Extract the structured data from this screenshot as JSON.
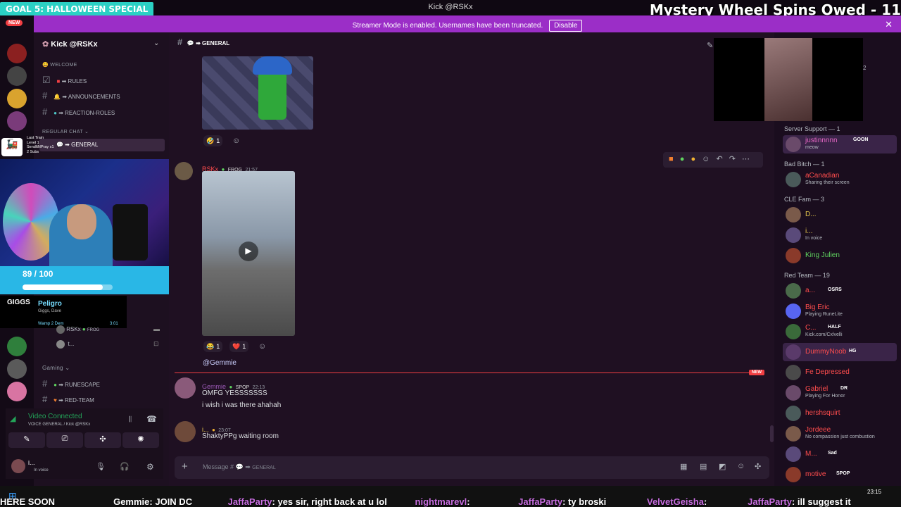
{
  "overlay": {
    "goal_label": "GOAL 5: HALLOWEEN SPECIAL",
    "window_title": "Kick @RSKx",
    "wheel_text": "Mystery Wheel Spins Owed - 11",
    "progress_text": "89 / 100",
    "train_lines": [
      "Last Train",
      "Level 1",
      "SendItNPray x1",
      "2 Subs"
    ],
    "alert_name": "Peligro",
    "alert_sub": "Giggs, Dave",
    "alert_game": "Wamp 2 Dem",
    "alert_timer": "3:01",
    "giggs_label": "GIGGS"
  },
  "banner": {
    "text": "Streamer Mode is enabled. Usernames have been truncated.",
    "button": "Disable",
    "close": "✕"
  },
  "rail": {
    "new_badge": "NEW"
  },
  "sidebar": {
    "server_name": "Kick @RSKx",
    "categories": [
      {
        "name": "WELCOME",
        "emoji": "😀"
      },
      {
        "name": "REGULAR CHAT"
      },
      {
        "name": "Gaming"
      }
    ],
    "channels": [
      "RULES",
      "ANNOUNCEMENTS",
      "REACTION-ROLES",
      "GENERAL",
      "RUNESCAPE",
      "RED-TEAM"
    ],
    "voice_users": [
      {
        "name": "RSKx",
        "tag": "FROG"
      },
      {
        "name": "t..."
      }
    ],
    "voice_connected": {
      "title": "Video Connected",
      "sub": "VOICE GENERAL / Kick @RSKx"
    },
    "user": {
      "name": "i...",
      "status": "In voice"
    }
  },
  "channel": {
    "name": "GENERAL",
    "placeholder": "Message #",
    "placeholder_channel": "GENERAL"
  },
  "messages": [
    {
      "reactions": [
        {
          "emoji": "🤣",
          "count": "1"
        }
      ]
    },
    {
      "author": "RSKx",
      "tag": "FROG",
      "time": "21:57",
      "reactions": [
        {
          "emoji": "😂",
          "count": "1"
        },
        {
          "emoji": "❤️",
          "count": "1"
        }
      ],
      "mention": "@Gemmie"
    },
    {
      "author": "Gemmie",
      "tag": "SPOP",
      "time": "22:13",
      "lines": [
        "OMFG YESSSSSSS",
        "i wish i was there ahahah"
      ]
    },
    {
      "author": "i...",
      "time": "23:07",
      "lines": [
        "ShaktyPPg waiting room"
      ]
    }
  ],
  "new_label": "NEW",
  "members": {
    "popup_count": "2",
    "groups": [
      {
        "name": "Server Support — 1",
        "members": [
          {
            "name": "justinnnnn",
            "tag": "GOON",
            "status": "meow",
            "color": "#e667c5"
          }
        ]
      },
      {
        "name": "Bad Bitch — 1",
        "members": [
          {
            "name": "aCanadian",
            "status": "Sharing their screen",
            "color": "#ff4d4d"
          }
        ]
      },
      {
        "name": "CLE Fam — 3",
        "members": [
          {
            "name": "D...",
            "color": "#e3c54a"
          },
          {
            "name": "i...",
            "status": "In voice",
            "color": "#e3c54a"
          },
          {
            "name": "King Julien",
            "color": "#5fd35f"
          }
        ]
      },
      {
        "name": "Red Team — 19",
        "members": [
          {
            "name": "a...",
            "tag": "OSRS",
            "color": "#ff4d4d"
          },
          {
            "name": "Big Eric",
            "status": "Playing RuneLite",
            "color": "#ff4d4d"
          },
          {
            "name": "C...",
            "tag": "HALF",
            "status": "Kick.com/Cxlvelli",
            "color": "#ff4d4d"
          },
          {
            "name": "DummyNoob",
            "tag": "HG",
            "color": "#ff4d4d"
          },
          {
            "name": "Fe Depressed",
            "color": "#ff4d4d"
          },
          {
            "name": "Gabriel",
            "tag": "DR",
            "status": "Playing For Honor",
            "color": "#ff4d4d"
          },
          {
            "name": "hershsquirt",
            "color": "#ff4d4d"
          },
          {
            "name": "Jordeee",
            "status": "No compassion just combustion",
            "color": "#ff4d4d"
          },
          {
            "name": "M...",
            "tag": "Sad",
            "color": "#ff4d4d"
          },
          {
            "name": "motive",
            "tag": "SPOP",
            "color": "#ff4d4d"
          }
        ]
      }
    ]
  },
  "ticker": {
    "items": [
      {
        "user": "",
        "text": "HERE SOON"
      },
      {
        "user": "Gemmie",
        "text": ": JOIN DC"
      },
      {
        "user": "JaffaParty",
        "text": ": yes sir, right back at u lol"
      },
      {
        "user": "nightmarevl",
        "text": ":"
      },
      {
        "user": "JaffaParty",
        "text": ": ty broski"
      },
      {
        "user": "VelvetGeisha",
        "text": ":"
      },
      {
        "user": "JaffaParty",
        "text": ": ill suggest it"
      }
    ]
  },
  "clock": "23:15"
}
